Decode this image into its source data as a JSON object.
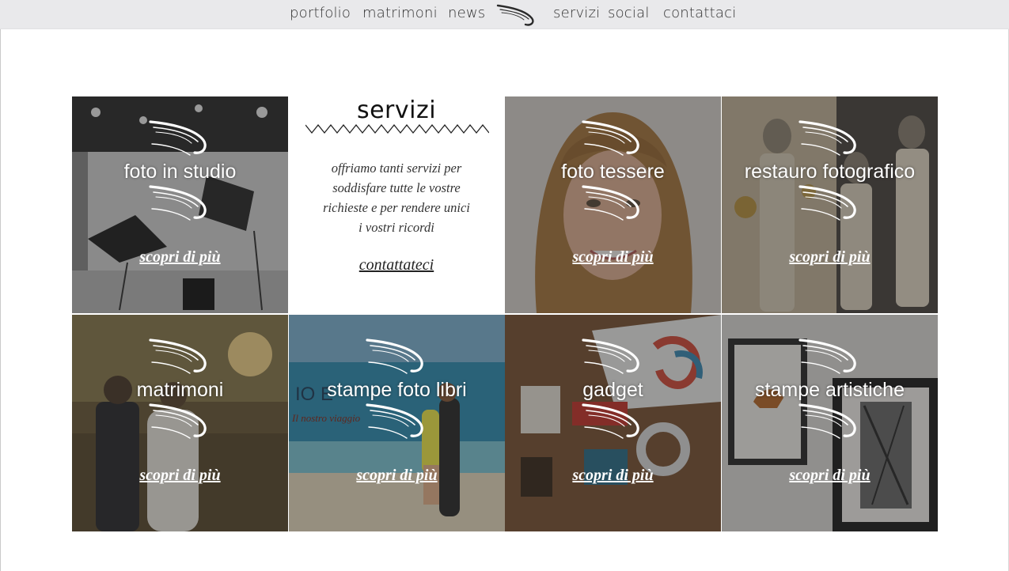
{
  "nav": {
    "left": [
      "portfolio",
      "matrimoni",
      "news"
    ],
    "right": [
      "servizi",
      "social",
      "contattaci"
    ]
  },
  "intro": {
    "title": "servizi",
    "text": "offriamo tanti servizi per soddisfare tutte le vostre richieste e per rendere unici i vostri ricordi",
    "link": "contattateci"
  },
  "tiles": [
    {
      "title": "foto in studio",
      "link": "scopri di più"
    },
    {
      "title": "foto tessere",
      "link": "scopri di più"
    },
    {
      "title": "restauro fotografico",
      "link": "scopri di più"
    },
    {
      "title": "matrimoni",
      "link": "scopri di più"
    },
    {
      "title": "stampe foto libri",
      "link": "scopri di più",
      "photo_text": [
        "IO E",
        "Il nostro viaggio"
      ]
    },
    {
      "title": "gadget",
      "link": "scopri di più"
    },
    {
      "title": "stampe artistiche",
      "link": "scopri di più"
    }
  ],
  "icons": {
    "nav_logo": "swash-flourish-icon",
    "tile_ornament": "swash-flourish-icon"
  },
  "colors": {
    "nav_bg": "#e9e9eb",
    "nav_text": "#333333",
    "overlay": "rgba(35,35,35,0.42)",
    "tile_text": "#ffffff"
  }
}
